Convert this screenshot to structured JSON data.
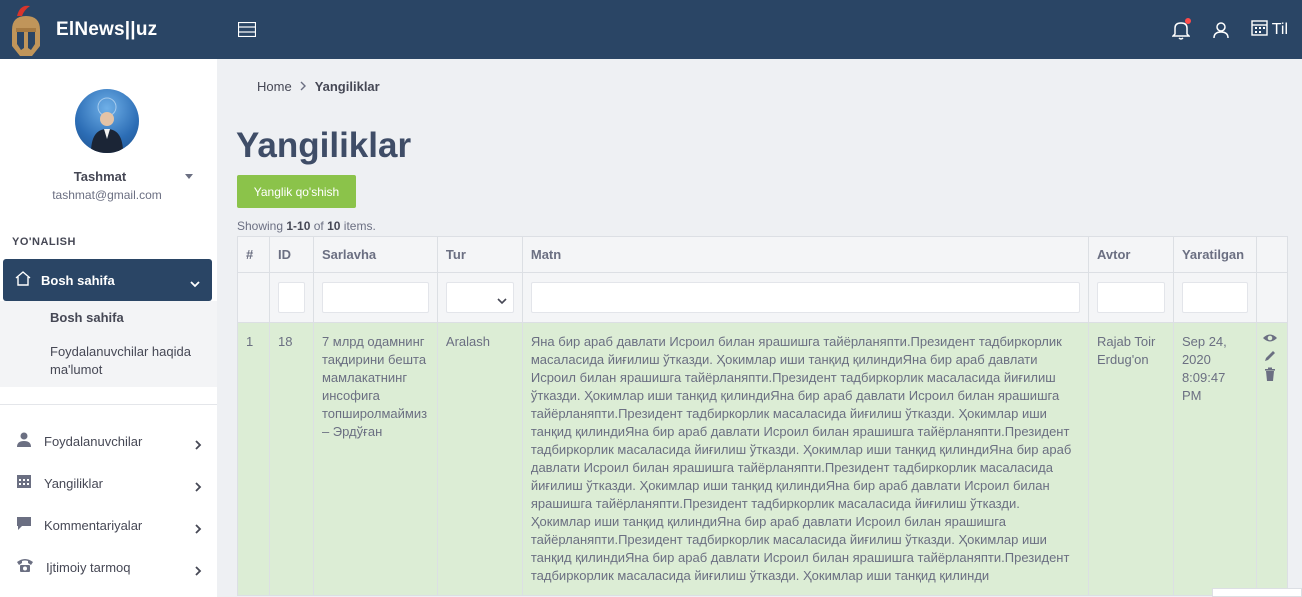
{
  "brand": {
    "title": "ElNews||uz"
  },
  "topbar": {
    "lang_label": "Til"
  },
  "user": {
    "name": "Tashmat",
    "email": "tashmat@gmail.com"
  },
  "sidebar": {
    "section_label": "YO'NALISH",
    "active_item": "Bosh sahifa",
    "submenu": [
      "Bosh sahifa",
      "Foydalanuvchilar haqida ma'lumot"
    ],
    "items": [
      {
        "label": "Foydalanuvchilar",
        "icon": "user-icon"
      },
      {
        "label": "Yangiliklar",
        "icon": "calendar-icon"
      },
      {
        "label": "Kommentariyalar",
        "icon": "chat-icon"
      },
      {
        "label": "Ijtimoiy tarmoq",
        "icon": "phone-icon"
      }
    ]
  },
  "breadcrumb": {
    "home": "Home",
    "current": "Yangiliklar"
  },
  "page": {
    "title": "Yangiliklar",
    "add_button": "Yanglik qo'shish"
  },
  "summary": {
    "prefix": "Showing ",
    "range": "1-10",
    "of": " of ",
    "total": "10",
    "suffix": " items."
  },
  "table": {
    "columns": [
      "#",
      "ID",
      "Sarlavha",
      "Tur",
      "Matn",
      "Avtor",
      "Yaratilgan"
    ],
    "rows": [
      {
        "num": "1",
        "id": "18",
        "title": "7 млрд одамнинг тақдирини бешта мамлакатнинг инсофига топширолмаймиз – Эрдўғaн",
        "type": "Aralash",
        "text": "Яна бир араб давлати Исроил билан ярашишга тайёрланяпти.Президент тадбиркорлик масаласида йиғилиш ўтказди. Ҳокимлар иши танқид қилиндиЯна бир араб давлати Исроил билан ярашишга тайёрланяпти.Президент тадбиркорлик масаласида йиғилиш ўтказди. Ҳокимлар иши танқид қилиндиЯна бир араб давлати Исроил билан ярашишга тайёрланяпти.Президент тадбиркорлик масаласида йиғилиш ўтказди. Ҳокимлар иши танқид қилиндиЯна бир араб давлати Исроил билан ярашишга тайёрланяпти.Президент тадбиркорлик масаласида йиғилиш ўтказди. Ҳокимлар иши танқид қилиндиЯна бир араб давлати Исроил билан ярашишга тайёрланяпти.Президент тадбиркорлик масаласида йиғилиш ўтказди. Ҳокимлар иши танқид қилиндиЯна бир араб давлати Исроил билан ярашишга тайёрланяпти.Президент тадбиркорлик масаласида йиғилиш ўтказди. Ҳокимлар иши танқид қилиндиЯна бир араб давлати Исроил билан ярашишга тайёрланяпти.Президент тадбиркорлик масаласида йиғилиш ўтказди. Ҳокимлар иши танқид қилиндиЯна бир араб давлати Исроил билан ярашишга тайёрланяпти.Президент тадбиркорлик масаласида йиғилиш ўтказди. Ҳокимлар иши танқид қилинди",
        "author": "Rajab Toir Erdug'on",
        "created": "Sep 24, 2020 8:09:47 PM"
      }
    ]
  },
  "colors": {
    "header": "#2a4565",
    "accent_button": "#8bc34a",
    "row_highlight": "#dcedd5",
    "notification": "#ff4a4a"
  }
}
